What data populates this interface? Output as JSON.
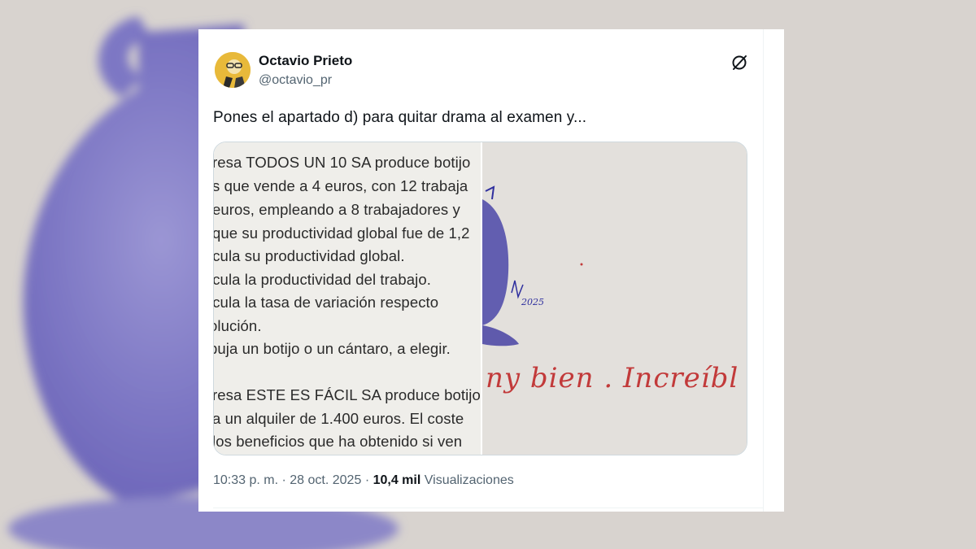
{
  "background": {
    "color": "#d6d1cc",
    "pen_color": "#6b64b8"
  },
  "tweet": {
    "author_name": "Octavio Prieto",
    "author_handle": "@octavio_pr",
    "text": "Pones el apartado d) para quitar drama al examen y...",
    "time": "10:33 p. m.",
    "separator": "·",
    "date": "28 oct. 2025",
    "views_count": "10,4 mil",
    "views_label": "Visualizaciones"
  },
  "media": {
    "left_image_lines": [
      "resa TODOS UN 10 SA produce botijo",
      "s que vende a 4 euros, con 12 trabaja",
      "euros, empleando a 8 trabajadores y",
      "que su productividad global fue de 1,2",
      "lcula su productividad global.",
      "lcula la productividad del trabajo.",
      "lcula la tasa de variación respecto",
      "olución.",
      "buja un botijo o un cántaro, a elegir.",
      "",
      "resa ESTE ES FÁCIL SA produce botijo",
      "a un alquiler de 1.400 euros. El coste",
      "los beneficios que ha obtenido si ven"
    ],
    "right_image_handwriting": "ny bien . Increíbl",
    "right_image_signature": "2025",
    "ink_red": "#c23a3a",
    "ink_blue": "#2f2f9e"
  },
  "icons": {
    "grok": "grok-icon",
    "avatar": "avatar"
  }
}
